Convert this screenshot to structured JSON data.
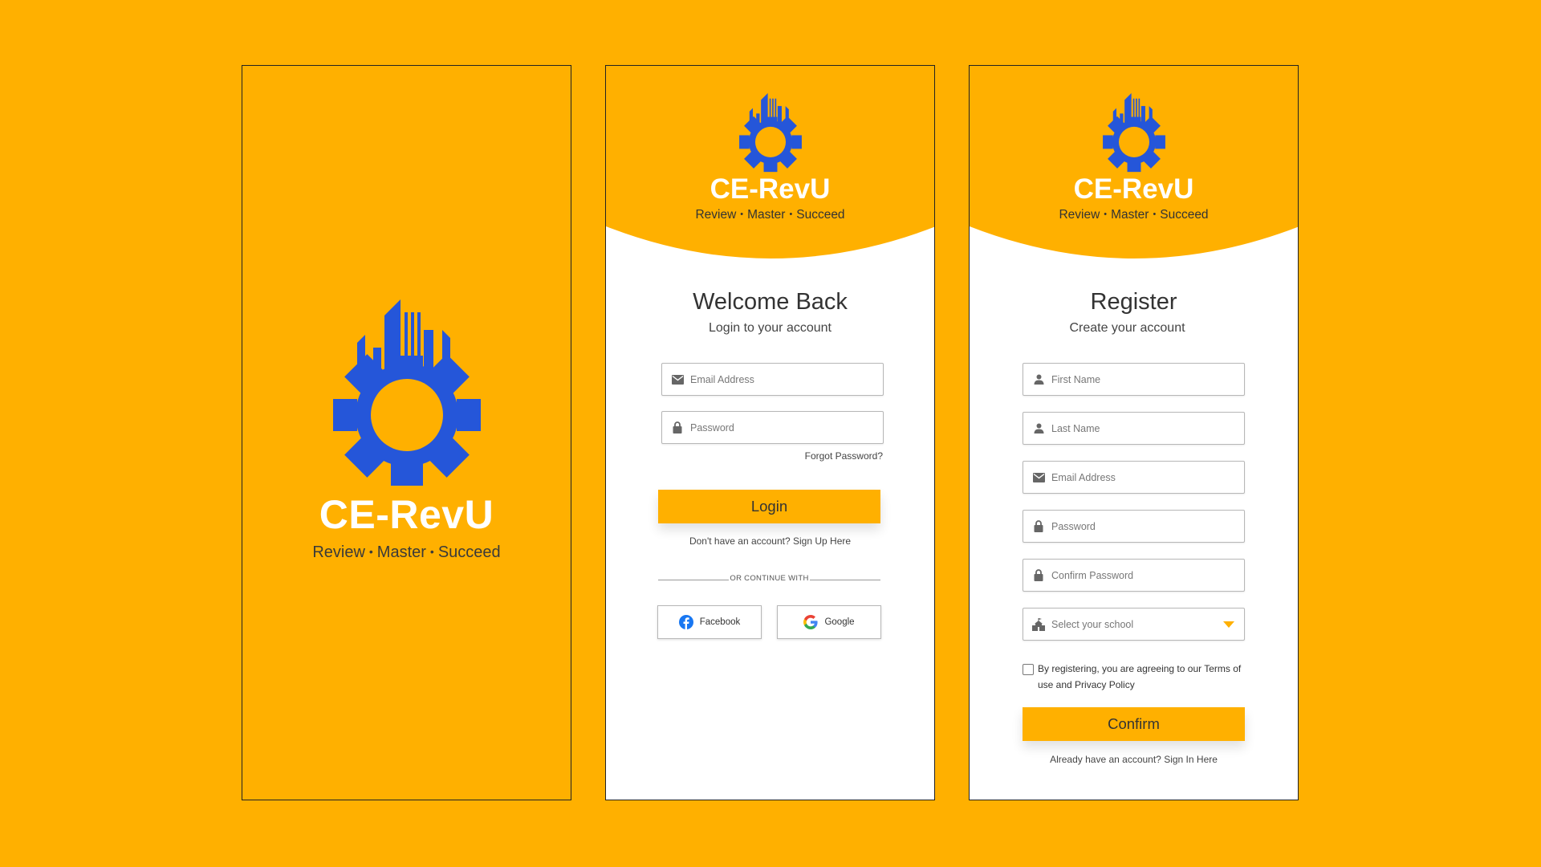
{
  "colors": {
    "brand_yellow": "#FFB000",
    "logo_blue": "#2556D9",
    "white": "#FFFFFF"
  },
  "brand": {
    "name": "CE-RevU",
    "tagline": [
      "Review",
      "Master",
      "Succeed"
    ],
    "logo_icon": "gear-buildings-icon"
  },
  "login": {
    "title": "Welcome Back",
    "subtitle": "Login to your account",
    "email_placeholder": "Email Address",
    "password_placeholder": "Password",
    "forgot_password": "Forgot Password?",
    "login_button": "Login",
    "no_account_text": "Don't have an account?",
    "sign_up_link": "Sign Up Here",
    "divider_text": "OR CONTINUE WITH",
    "facebook_label": "Facebook",
    "google_label": "Google"
  },
  "register": {
    "title": "Register",
    "subtitle": "Create your account",
    "first_name_placeholder": "First Name",
    "last_name_placeholder": "Last Name",
    "email_placeholder": "Email Address",
    "password_placeholder": "Password",
    "confirm_password_placeholder": "Confirm Password",
    "school_placeholder": "Select your school",
    "terms_text": "By registering, you are agreeing to our Terms of use and Privacy Policy",
    "terms_checked": false,
    "confirm_button": "Confirm",
    "have_account_text": "Already have an account?",
    "sign_in_link": "Sign In Here"
  }
}
